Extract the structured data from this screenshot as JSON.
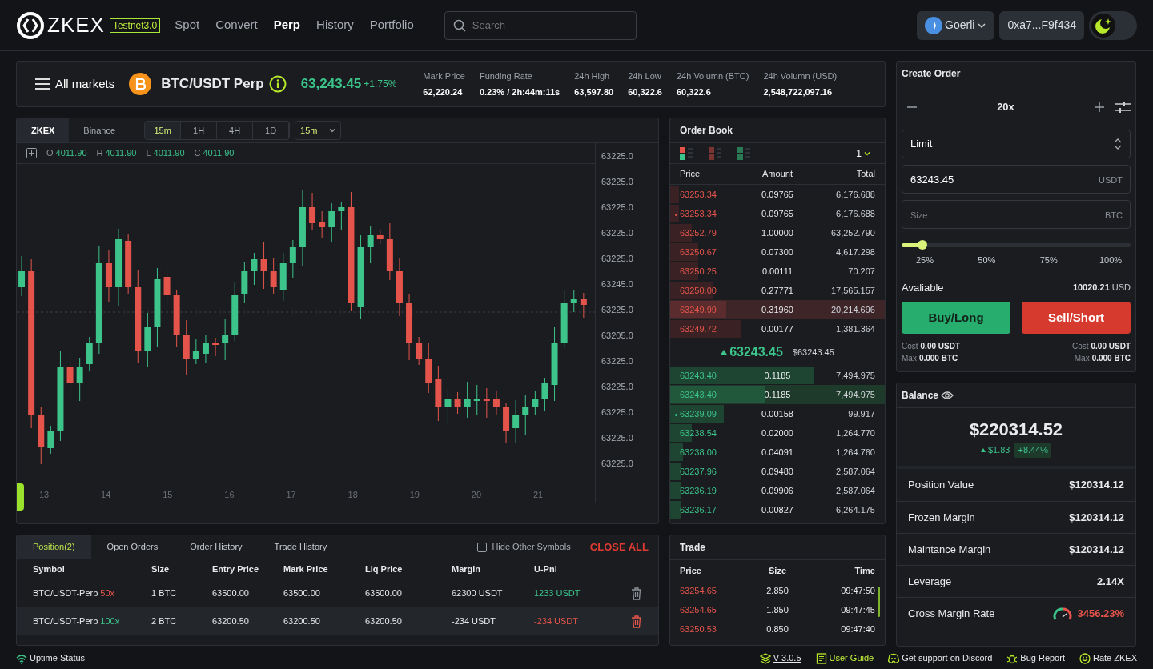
{
  "header": {
    "logo": "ZKEX",
    "badge": "Testnet3.0",
    "nav": [
      {
        "label": "Spot",
        "selected": false
      },
      {
        "label": "Convert",
        "selected": false
      },
      {
        "label": "Perp",
        "selected": true
      },
      {
        "label": "History",
        "selected": false
      },
      {
        "label": "Portfolio",
        "selected": false
      }
    ],
    "search": {
      "placeholder": "Search"
    },
    "network": "Goerli",
    "address": "0xa7...F9f434",
    "dark_mode": true
  },
  "ticker": {
    "markets_label": "All markets",
    "pair": "BTC/USDT Perp",
    "price": "63,243.45",
    "change": "+1.75%",
    "stats": [
      {
        "label": "Mark Price",
        "value": "62,220.24"
      },
      {
        "label": "Funding Rate",
        "value": "0.23% / 2h:44m:11s"
      },
      {
        "label": "24h High",
        "value": "63,597.80"
      },
      {
        "label": "24h Low",
        "value": "60,322.6"
      },
      {
        "label": "24h Volumn (BTC)",
        "value": "60,322.6"
      },
      {
        "label": "24h Volumn (USD)",
        "value": "2,548,722,097.16"
      }
    ]
  },
  "chart": {
    "sources": [
      {
        "label": "ZKEX",
        "selected": true
      },
      {
        "label": "Binance",
        "selected": false
      }
    ],
    "intervals": [
      {
        "label": "15m",
        "selected": true
      },
      {
        "label": "1H",
        "selected": false
      },
      {
        "label": "4H",
        "selected": false
      },
      {
        "label": "1D",
        "selected": false
      }
    ],
    "interval_select": "15m",
    "ohlc": [
      {
        "label": "O",
        "value": "4011.90"
      },
      {
        "label": "H",
        "value": "4011.90"
      },
      {
        "label": "L",
        "value": "4011.90"
      },
      {
        "label": "C",
        "value": "4011.90"
      }
    ],
    "y_labels": [
      "63225.0",
      "63225.0",
      "63225.0",
      "63225.0",
      "63225.0",
      "63245.0",
      "63225.0",
      "63205.0",
      "63225.0",
      "63225.0",
      "63225.0",
      "63225.0",
      "63225.0"
    ],
    "x_labels": [
      "13",
      "14",
      "15",
      "16",
      "17",
      "18",
      "19",
      "20",
      "21"
    ]
  },
  "order_book": {
    "title": "Order Book",
    "precision": "1",
    "columns": [
      "Price",
      "Amount",
      "Total"
    ],
    "asks": [
      {
        "price": "63253.34",
        "amount": "0.09765",
        "total": "6,176.688",
        "level": 0.04,
        "marked": false,
        "highlighted": false
      },
      {
        "price": "63253.34",
        "amount": "0.09765",
        "total": "6,176.688",
        "level": 0.04,
        "marked": true,
        "highlighted": false
      },
      {
        "price": "63252.79",
        "amount": "1.00000",
        "total": "63,252.790",
        "level": 0.1,
        "marked": false,
        "highlighted": false
      },
      {
        "price": "63250.67",
        "amount": "0.07300",
        "total": "4,617.298",
        "level": 0.13,
        "marked": false,
        "highlighted": false
      },
      {
        "price": "63250.25",
        "amount": "0.00111",
        "total": "70.207",
        "level": 0.13,
        "marked": false,
        "highlighted": false
      },
      {
        "price": "63250.00",
        "amount": "0.27771",
        "total": "17,565.157",
        "level": 0.2,
        "marked": false,
        "highlighted": false
      },
      {
        "price": "63249.99",
        "amount": "0.31960",
        "total": "20,214.696",
        "level": 0.26,
        "marked": false,
        "highlighted": true
      },
      {
        "price": "63249.72",
        "amount": "0.00177",
        "total": "1,381.364",
        "level": 0.33,
        "marked": false,
        "highlighted": false
      }
    ],
    "last_price": "63243.45",
    "rising": true,
    "last_price_usd": "$63243.45",
    "bids": [
      {
        "price": "63243.40",
        "amount": "0.1185",
        "total": "7,494.975",
        "level": 0.67,
        "marked": false,
        "highlighted": false
      },
      {
        "price": "63243.40",
        "amount": "0.1185",
        "total": "7,494.975",
        "level": 0.44,
        "marked": false,
        "highlighted": true
      },
      {
        "price": "63239.09",
        "amount": "0.00158",
        "total": "99.917",
        "level": 0.25,
        "marked": true,
        "highlighted": false
      },
      {
        "price": "63238.54",
        "amount": "0.02000",
        "total": "1,264.770",
        "level": 0.1,
        "marked": false,
        "highlighted": false
      },
      {
        "price": "63238.00",
        "amount": "0.04091",
        "total": "1,264.760",
        "level": 0.06,
        "marked": false,
        "highlighted": false
      },
      {
        "price": "63237.96",
        "amount": "0.09480",
        "total": "2,587.064",
        "level": 0.05,
        "marked": false,
        "highlighted": false
      },
      {
        "price": "63236.19",
        "amount": "0.09906",
        "total": "2,587.064",
        "level": 0.05,
        "marked": false,
        "highlighted": false
      },
      {
        "price": "63236.17",
        "amount": "0.00827",
        "total": "6,264.175",
        "level": 0.05,
        "marked": false,
        "highlighted": false
      }
    ]
  },
  "create_order": {
    "title": "Create Order",
    "leverage": "20x",
    "order_type": "Limit",
    "price": {
      "value": "63243.45",
      "unit": "USDT"
    },
    "size": {
      "placeholder": "Size",
      "unit": "BTC"
    },
    "slider": {
      "level": 0.09,
      "marks": [
        "25%",
        "50%",
        "75%",
        "100%"
      ]
    },
    "available": {
      "label": "Avaliable",
      "value": "10020.21",
      "unit": "USD"
    },
    "buy": {
      "label": "Buy/Long",
      "cost_label": "Cost",
      "cost": "0.00 USDT",
      "max_label": "Max",
      "max": "0.000 BTC"
    },
    "sell": {
      "label": "Sell/Short",
      "cost_label": "Cost",
      "cost": "0.00 USDT",
      "max_label": "Max",
      "max": "0.000 BTC"
    }
  },
  "balance": {
    "title": "Balance",
    "total": "$220314.52",
    "change": "$1.83",
    "change_pct": "+8.44%",
    "rows": [
      {
        "label": "Position Value",
        "value": "$120314.12",
        "alert": false
      },
      {
        "label": "Frozen Margin",
        "value": "$120314.12",
        "alert": false
      },
      {
        "label": "Maintance Margin",
        "value": "$120314.12",
        "alert": false
      },
      {
        "label": "Leverage",
        "value": "2.14X",
        "alert": false
      },
      {
        "label": "Cross Margin Rate",
        "value": "3456.23%",
        "alert": true
      }
    ]
  },
  "positions": {
    "tabs": [
      {
        "label": "Position(2)",
        "selected": true
      },
      {
        "label": "Open Orders",
        "selected": false
      },
      {
        "label": "Order History",
        "selected": false
      },
      {
        "label": "Trade History",
        "selected": false
      }
    ],
    "hide_other": {
      "label": "Hide Other Symbols",
      "checked": false
    },
    "close_all": "CLOSE ALL",
    "columns": [
      "Symbol",
      "Size",
      "Entry Price",
      "Mark Price",
      "Liq Price",
      "Margin",
      "U-Pnl"
    ],
    "rows": [
      {
        "symbol": "BTC/USDT-Perp",
        "leverage": "50x",
        "long": false,
        "size": "1 BTC",
        "entry": "63500.00",
        "mark": "63500.00",
        "liq": "63500.00",
        "margin": "62300 USDT",
        "pnl": "1233 USDT",
        "profit": true,
        "selected": false
      },
      {
        "symbol": "BTC/USDT-Perp",
        "leverage": "100x",
        "long": true,
        "size": "2 BTC",
        "entry": "63200.50",
        "mark": "63200.50",
        "liq": "63200.50",
        "margin": "-234 USDT",
        "pnl": "-234 USDT",
        "profit": false,
        "selected": true
      }
    ]
  },
  "trades": {
    "title": "Trade",
    "columns": [
      "Price",
      "Size",
      "Time"
    ],
    "rows": [
      {
        "price": "63254.65",
        "size": "2.850",
        "time": "09:47:50",
        "buy": false
      },
      {
        "price": "63254.65",
        "size": "1.850",
        "time": "09:47:45",
        "buy": false
      },
      {
        "price": "63250.53",
        "size": "0.850",
        "time": "09:47:40",
        "buy": false
      }
    ]
  },
  "footer": {
    "items": [
      {
        "kind": "uptime",
        "label": "Uptime Status"
      },
      {
        "kind": "version",
        "label": "V 3.0.5"
      },
      {
        "kind": "guide",
        "label": "User Guide"
      },
      {
        "kind": "discord",
        "label": "Get support on Discord"
      },
      {
        "kind": "bug",
        "label": "Bug Report"
      },
      {
        "kind": "rate",
        "label": "Rate ZKEX"
      }
    ]
  }
}
